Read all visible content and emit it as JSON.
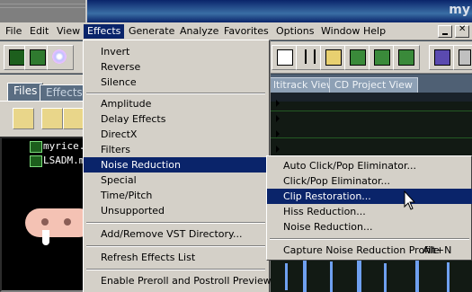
{
  "window": {
    "title": "my"
  },
  "menubar": [
    "File",
    "Edit",
    "View",
    "Effects",
    "Generate",
    "Analyze",
    "Favorites",
    "Options",
    "Window",
    "Help"
  ],
  "menubar_active": "Effects",
  "left_panel": {
    "tabs": [
      "Files",
      "Effects"
    ],
    "files": [
      "myrice.",
      "LSADM.m"
    ]
  },
  "view_tabs": [
    "ltitrack View",
    "CD Project View"
  ],
  "effects_menu": {
    "items": [
      "Invert",
      "Reverse",
      "Silence",
      "Amplitude",
      "Delay Effects",
      "DirectX",
      "Filters",
      "Noise Reduction",
      "Special",
      "Time/Pitch",
      "Unsupported",
      "Add/Remove VST Directory...",
      "Refresh Effects List",
      "Enable Preroll and Postroll Preview"
    ],
    "highlighted": "Noise Reduction"
  },
  "noise_submenu": {
    "items": [
      "Auto Click/Pop Eliminator...",
      "Click/Pop Eliminator...",
      "Clip Restoration...",
      "Hiss Reduction...",
      "Noise Reduction...",
      "Capture Noise Reduction Profile"
    ],
    "shortcut": "Alt+N",
    "highlighted": "Clip Restoration..."
  },
  "colors": {
    "menu_highlight": "#0a246a",
    "menu_bg": "#d4d0c8",
    "waveform": "#6fa0f0"
  },
  "icons": [
    "waveform-view-icon",
    "multitrack-view-icon",
    "cd-icon",
    "open-file-icon",
    "copy-icon",
    "cut-icon",
    "paste-icon",
    "vst-icon",
    "effect-icon",
    "close-icon",
    "minimize-icon",
    "cursor-icon"
  ]
}
